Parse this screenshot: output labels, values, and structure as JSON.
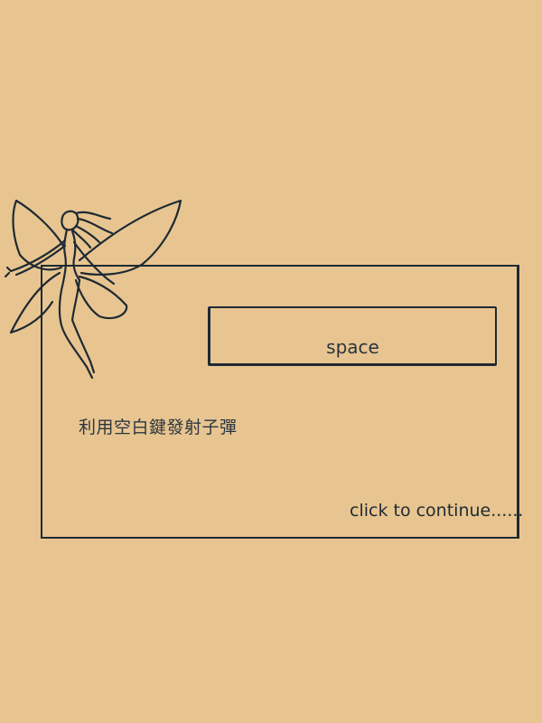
{
  "tutorial": {
    "key_name": "space",
    "instruction": "利用空白鍵發射子彈",
    "continue_label": "click to continue......"
  },
  "icons": {
    "fairy": "fairy-illustration"
  },
  "colors": {
    "background": "#e8c590",
    "ink": "#1e2a33"
  }
}
